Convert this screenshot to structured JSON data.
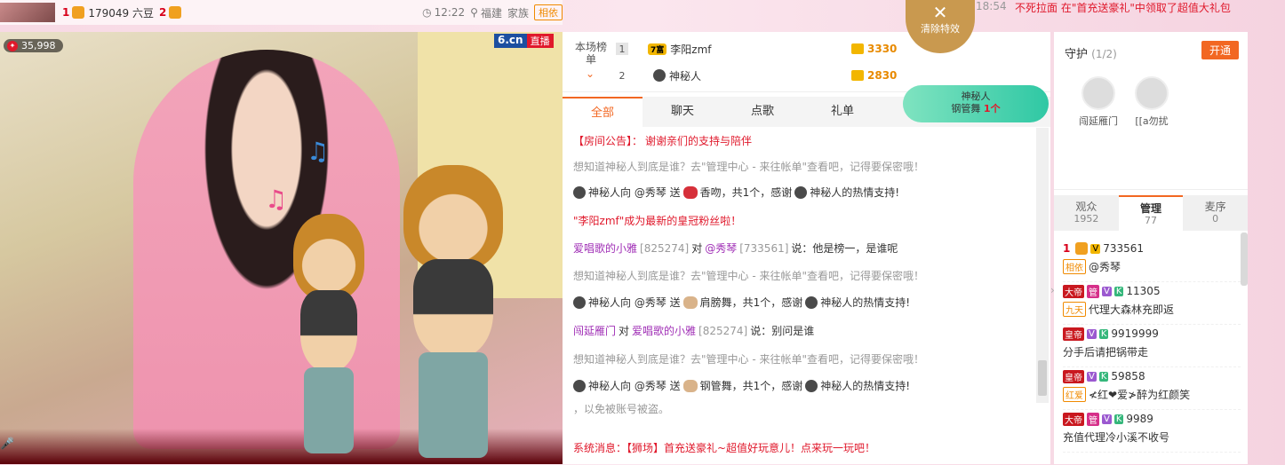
{
  "topbar": {
    "rank1": "1",
    "fans": "179049 六豆",
    "rank2": "2",
    "time": "12:22",
    "location": "福建",
    "family": "家族",
    "tag": "相依"
  },
  "announcement_top": {
    "time": "18:54",
    "text": "不死拉面 在\"首充送豪礼\"中领取了超值大礼包"
  },
  "close_effect": {
    "label": "清除特效"
  },
  "video": {
    "viewer_count": "35,998",
    "brand": "6.cn",
    "live": "直播"
  },
  "rank": {
    "label": "本场榜单",
    "rows": [
      {
        "num": "1",
        "level": "7富",
        "name": "李阳zmf",
        "score": "3330"
      },
      {
        "num": "2",
        "name": "神秘人",
        "score": "2830"
      }
    ]
  },
  "gift_float": {
    "user": "神秘人",
    "gift": "钢管舞",
    "count": "1个"
  },
  "tabs": [
    "全部",
    "聊天",
    "点歌",
    "礼单"
  ],
  "chat": {
    "notice_label": "【房间公告】：",
    "notice_text": "谢谢亲们的支持与陪伴",
    "lines": [
      "想知道神秘人到底是谁？去\"管理中心 - 来往帐单\"查看吧，记得要保密哦！",
      "神秘人向 @秀琴 送",
      "香吻，共1个，感谢",
      "神秘人的热情支持!",
      "\"李阳zmf\"成为最新的皇冠粉丝啦！",
      "爱唱歌的小雅",
      "[825274]",
      "对",
      "@秀琴",
      "[733561]",
      "说：他是榜一，是谁呢",
      "想知道神秘人到底是谁？去\"管理中心 - 来往帐单\"查看吧，记得要保密哦！",
      "神秘人向 @秀琴 送",
      "肩膀舞，共1个，感谢",
      "神秘人的热情支持!",
      "闯延雁门",
      "对",
      "爱唱歌的小雅",
      "[825274]",
      "说：别问是谁",
      "想知道神秘人到底是谁？去\"管理中心 - 来往帐单\"查看吧，记得要保密哦！",
      "神秘人向 @秀琴 送",
      "钢管舞，共1个，感谢",
      "神秘人的热情支持!",
      "，以免被账号被盗。"
    ],
    "system": "系统消息：【狮场】首充送豪礼~超值好玩意儿！点来玩一玩吧！"
  },
  "guard": {
    "title": "守护",
    "count": "(1/2)",
    "open_btn": "开通",
    "members": [
      "闯延雁门",
      "[[a勿扰"
    ]
  },
  "member_tabs": [
    {
      "label": "观众",
      "count": "1952"
    },
    {
      "label": "管理",
      "count": "77"
    },
    {
      "label": "麦序",
      "count": "0"
    }
  ],
  "members": [
    {
      "rank": "1",
      "id": "733561",
      "tag": "相依",
      "name": "@秀琴"
    },
    {
      "title": "大帝",
      "id": "11305",
      "tag": "九天",
      "name": "代理大森林充即返"
    },
    {
      "title": "皇帝",
      "id": "9919999",
      "name": "分手后请把锅带走"
    },
    {
      "title": "皇帝",
      "id": "59858",
      "tag": "红爱",
      "name": "≮红❤爱≯醉为红颜笑"
    },
    {
      "title": "大帝",
      "id": "9989",
      "name": "充值代理冷小溪不收号"
    }
  ],
  "colors": {
    "accent": "#f26722",
    "red": "#e0182b",
    "purple": "#a02fb6"
  }
}
